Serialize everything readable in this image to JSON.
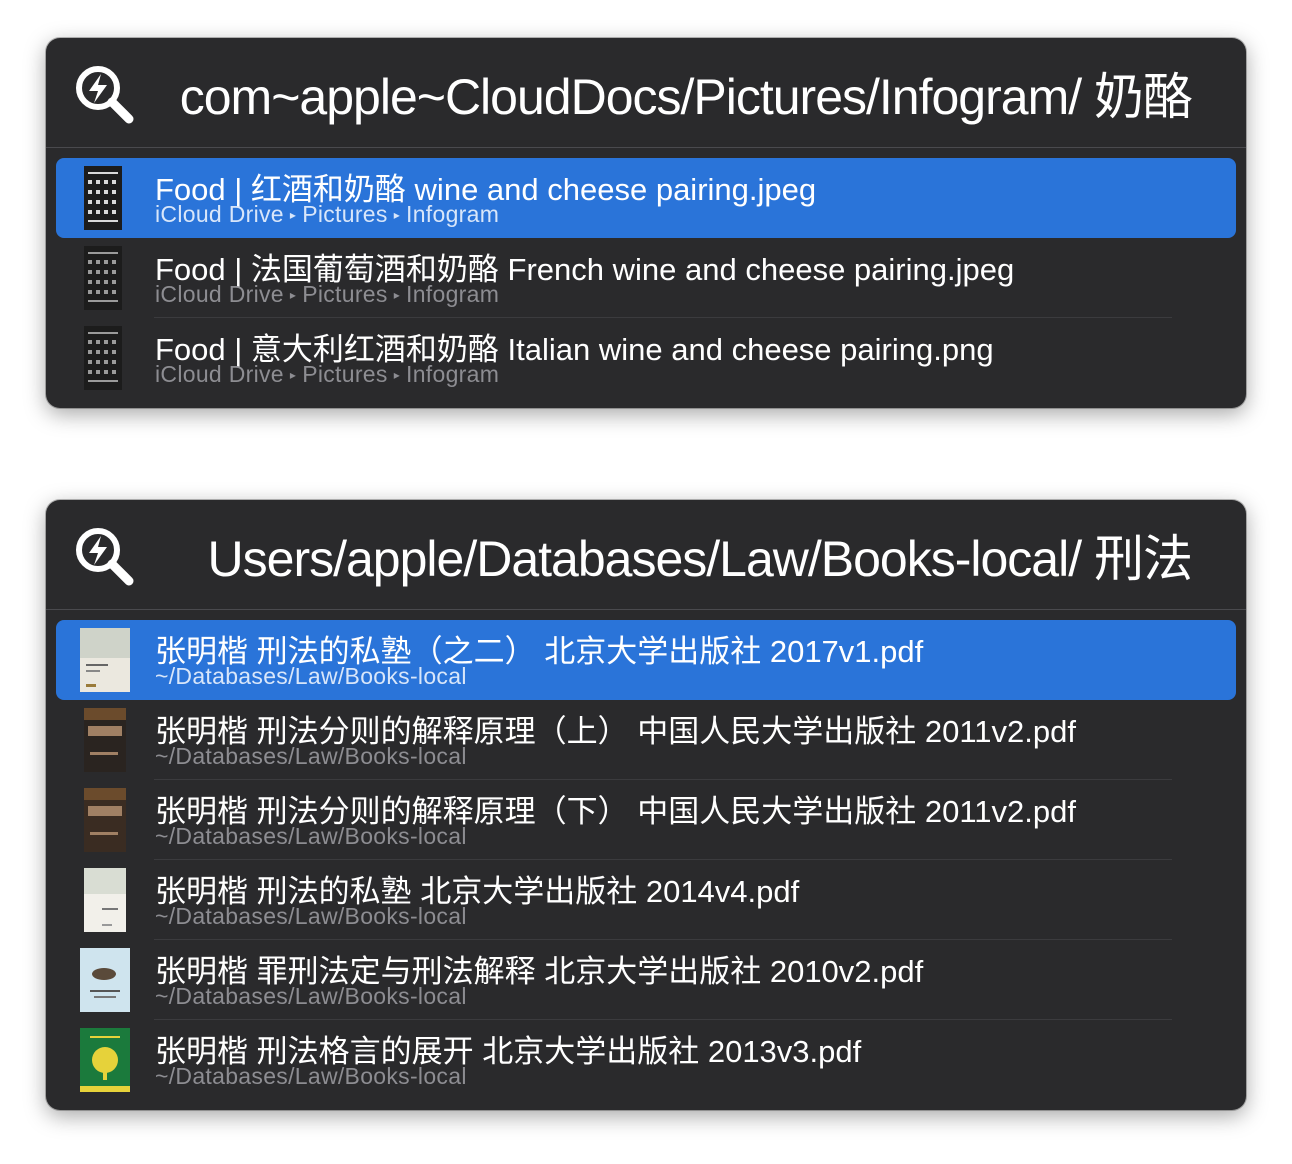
{
  "panel1": {
    "query": "com~apple~CloudDocs/Pictures/Infogram/  奶酪",
    "results": [
      {
        "title": "Food | 红酒和奶酪 wine and cheese pairing.jpeg",
        "path": [
          "iCloud Drive",
          "Pictures",
          "Infogram"
        ],
        "selected": true
      },
      {
        "title": "Food | 法国葡萄酒和奶酪 French wine and cheese pairing.jpeg",
        "path": [
          "iCloud Drive",
          "Pictures",
          "Infogram"
        ],
        "selected": false
      },
      {
        "title": "Food | 意大利红酒和奶酪 Italian wine and cheese pairing.png",
        "path": [
          "iCloud Drive",
          "Pictures",
          "Infogram"
        ],
        "selected": false
      }
    ]
  },
  "panel2": {
    "query": "Users/apple/Databases/Law/Books-local/  刑法",
    "results": [
      {
        "title": "张明楷 刑法的私塾（之二） 北京大学出版社 2017v1.pdf",
        "path": "~/Databases/Law/Books-local",
        "selected": true
      },
      {
        "title": "张明楷 刑法分则的解释原理（上） 中国人民大学出版社 2011v2.pdf",
        "path": "~/Databases/Law/Books-local",
        "selected": false
      },
      {
        "title": "张明楷 刑法分则的解释原理（下） 中国人民大学出版社 2011v2.pdf",
        "path": "~/Databases/Law/Books-local",
        "selected": false
      },
      {
        "title": "张明楷 刑法的私塾 北京大学出版社 2014v4.pdf",
        "path": "~/Databases/Law/Books-local",
        "selected": false
      },
      {
        "title": "张明楷 罪刑法定与刑法解释 北京大学出版社 2010v2.pdf",
        "path": "~/Databases/Law/Books-local",
        "selected": false
      },
      {
        "title": "张明楷 刑法格言的展开 北京大学出版社 2013v3.pdf",
        "path": "~/Databases/Law/Books-local",
        "selected": false
      }
    ]
  },
  "icons": {
    "launcher": "alfred-search-icon",
    "path_separator": "▸"
  },
  "colors": {
    "panel_bg": "#2a2a2c",
    "selection": "#2a74d9",
    "subtitle": "#8d8d92"
  }
}
